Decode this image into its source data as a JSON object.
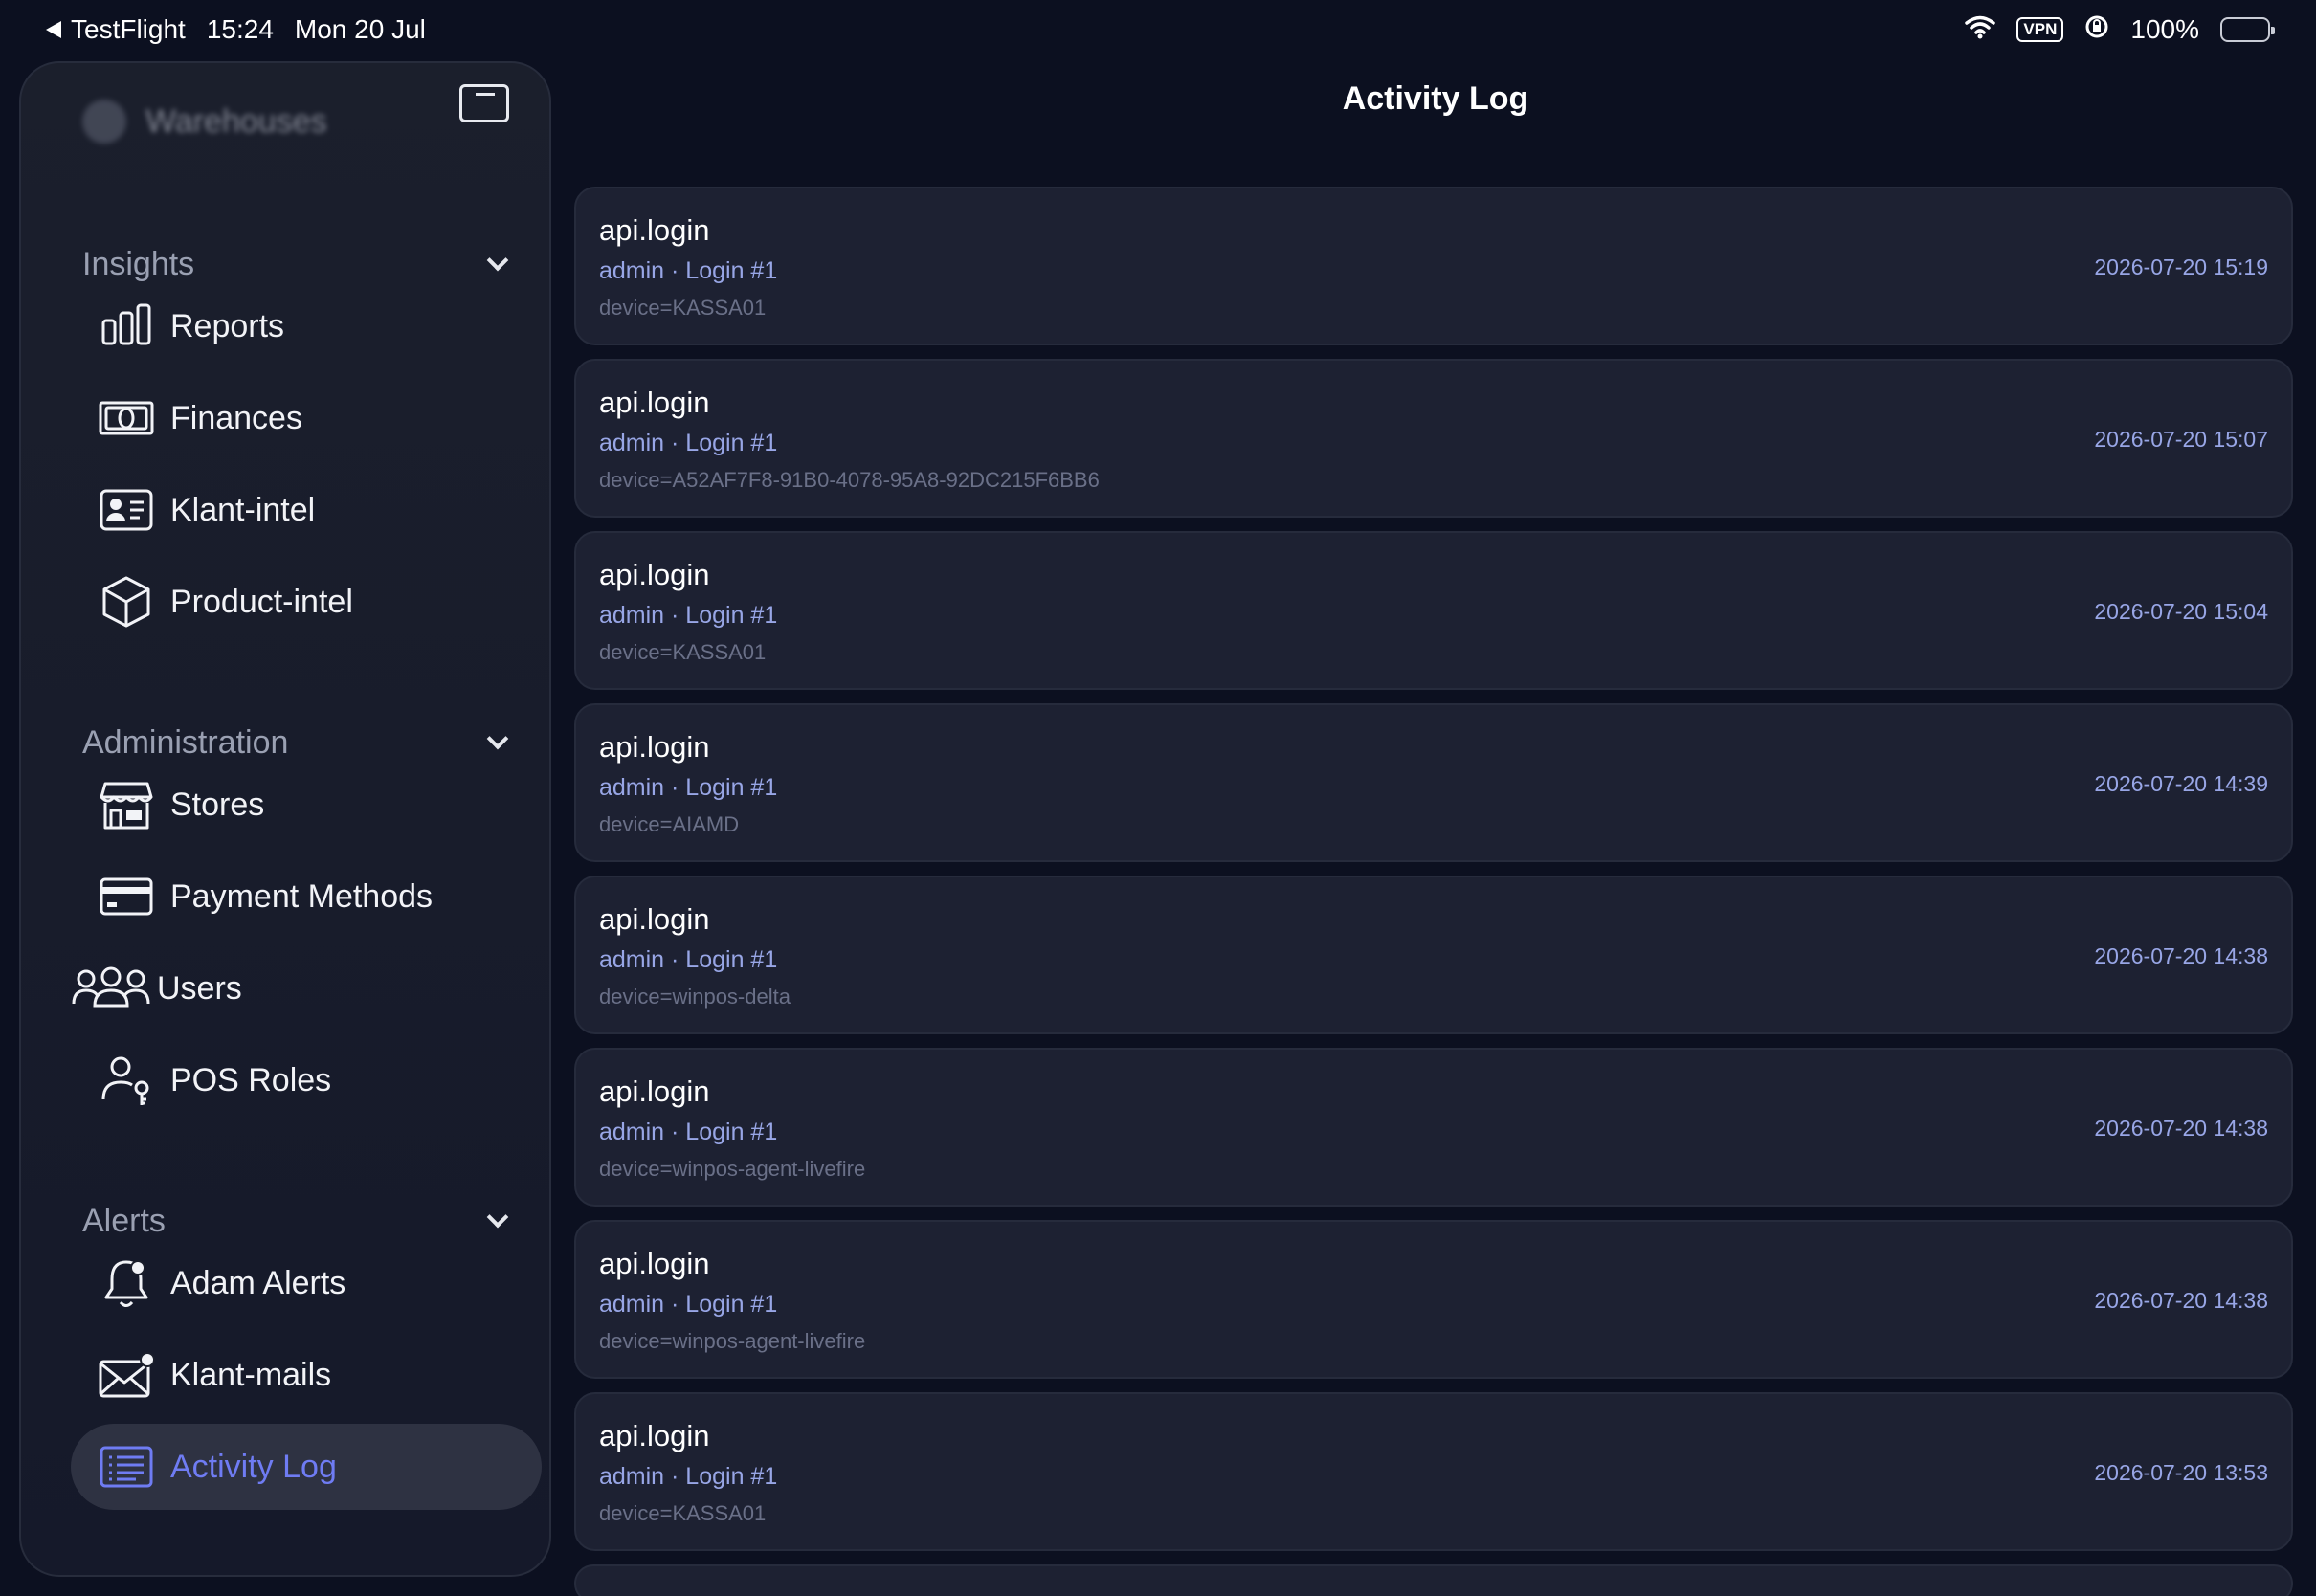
{
  "status_bar": {
    "back_app": "TestFlight",
    "time": "15:24",
    "date": "Mon 20 Jul",
    "vpn": "VPN",
    "battery": "100%"
  },
  "sidebar": {
    "workspace": "Warehouses",
    "sections": [
      {
        "title": "Insights",
        "items": [
          {
            "label": "Reports",
            "icon": "bar-chart-icon"
          },
          {
            "label": "Finances",
            "icon": "banknote-icon"
          },
          {
            "label": "Klant-intel",
            "icon": "contact-card-icon"
          },
          {
            "label": "Product-intel",
            "icon": "cube-icon"
          }
        ]
      },
      {
        "title": "Administration",
        "items": [
          {
            "label": "Stores",
            "icon": "storefront-icon"
          },
          {
            "label": "Payment Methods",
            "icon": "credit-card-icon"
          },
          {
            "label": "Users",
            "icon": "users-icon"
          },
          {
            "label": "POS Roles",
            "icon": "user-key-icon"
          }
        ]
      },
      {
        "title": "Alerts",
        "items": [
          {
            "label": "Adam Alerts",
            "icon": "bell-badge-icon"
          },
          {
            "label": "Klant-mails",
            "icon": "envelope-badge-icon"
          },
          {
            "label": "Activity Log",
            "icon": "list-icon",
            "active": true
          }
        ]
      }
    ]
  },
  "main": {
    "title": "Activity Log",
    "entries": [
      {
        "action": "api.login",
        "meta": "admin · Login #1",
        "detail": "device=KASSA01",
        "time": "2026-07-20 15:19"
      },
      {
        "action": "api.login",
        "meta": "admin · Login #1",
        "detail": "device=A52AF7F8-91B0-4078-95A8-92DC215F6BB6",
        "time": "2026-07-20 15:07"
      },
      {
        "action": "api.login",
        "meta": "admin · Login #1",
        "detail": "device=KASSA01",
        "time": "2026-07-20 15:04"
      },
      {
        "action": "api.login",
        "meta": "admin · Login #1",
        "detail": "device=AIAMD",
        "time": "2026-07-20 14:39"
      },
      {
        "action": "api.login",
        "meta": "admin · Login #1",
        "detail": "device=winpos-delta",
        "time": "2026-07-20 14:38"
      },
      {
        "action": "api.login",
        "meta": "admin · Login #1",
        "detail": "device=winpos-agent-livefire",
        "time": "2026-07-20 14:38"
      },
      {
        "action": "api.login",
        "meta": "admin · Login #1",
        "detail": "device=winpos-agent-livefire",
        "time": "2026-07-20 14:38"
      },
      {
        "action": "api.login",
        "meta": "admin · Login #1",
        "detail": "device=KASSA01",
        "time": "2026-07-20 13:53"
      }
    ]
  },
  "colors": {
    "background": "#0c1020",
    "sidebar": "#1b1f2c",
    "card": "#1d2132",
    "accent": "#6f7cf3",
    "meta_text": "#98a6e6"
  }
}
